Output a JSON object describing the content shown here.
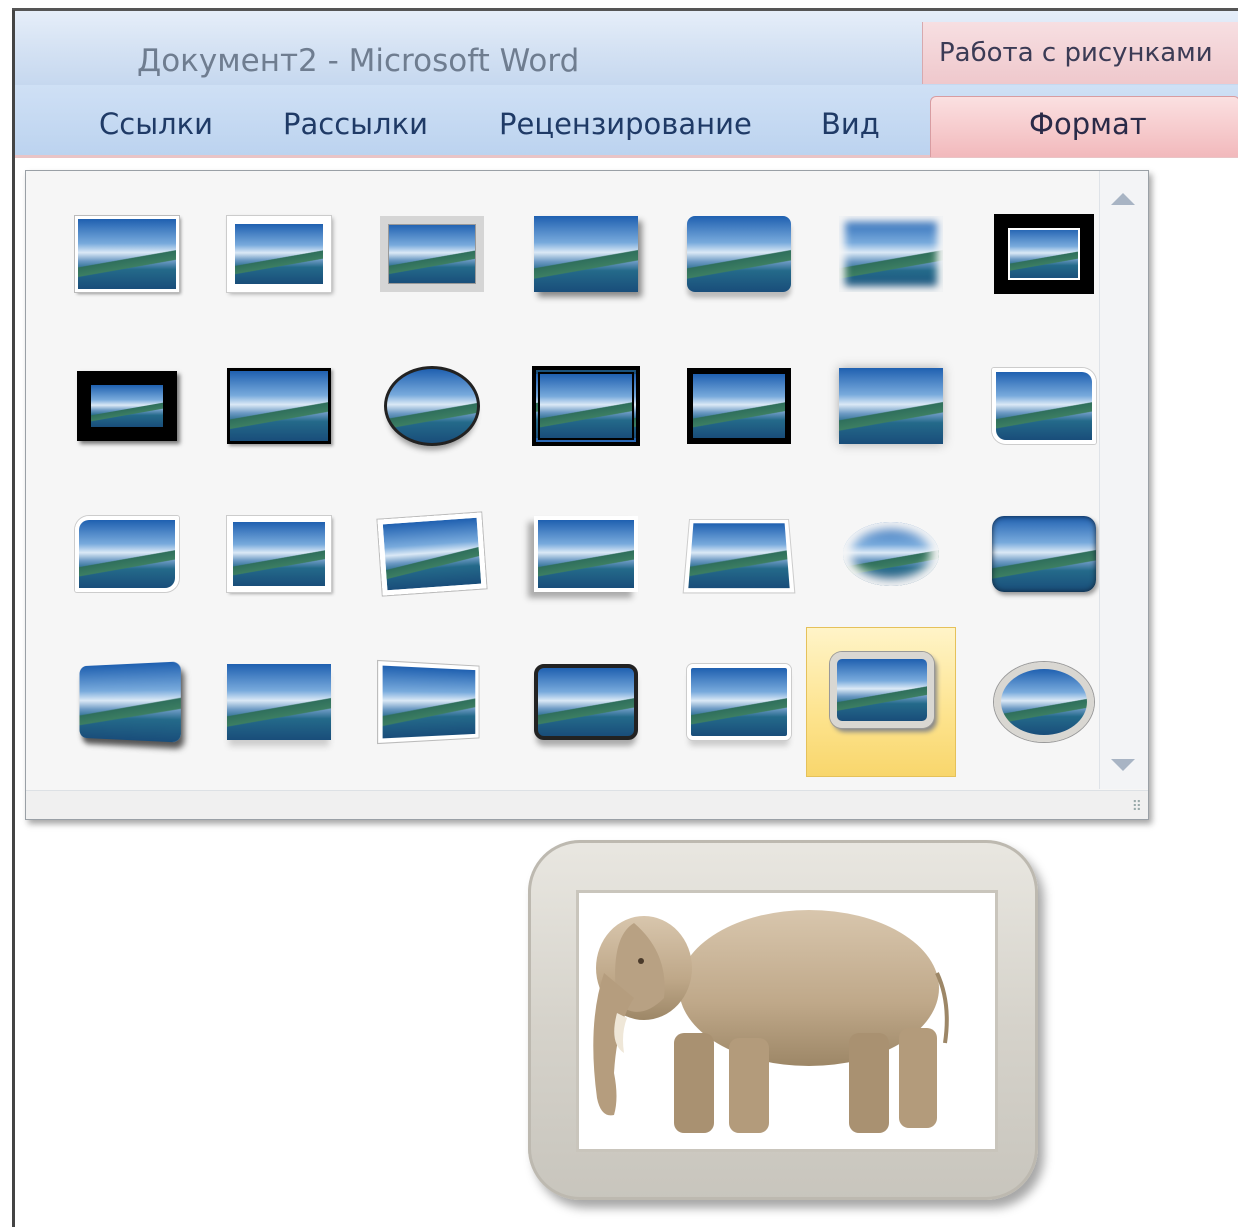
{
  "window": {
    "title": "Документ2 - Microsoft Word",
    "context_group": "Работа с рисунками"
  },
  "ribbon": {
    "tabs": [
      {
        "label": "Ссылки"
      },
      {
        "label": "Рассылки"
      },
      {
        "label": "Рецензирование"
      },
      {
        "label": "Вид"
      }
    ],
    "active_tab": "Формат"
  },
  "gallery": {
    "name": "picture-styles",
    "rows": 4,
    "columns": 7,
    "selected_index": 26,
    "styles": [
      "simple-frame-white",
      "beveled-matte-white",
      "metal-frame",
      "drop-shadow-rectangle",
      "reflected-rounded-rectangle",
      "soft-edge-rectangle",
      "double-frame-black",
      "thick-matte-black",
      "simple-frame-black",
      "beveled-oval-black",
      "compound-frame-black",
      "moderate-frame-black",
      "center-shadow-rectangle",
      "rounded-diagonal-corner-white",
      "snip-diagonal-corner-white",
      "moderate-frame-white",
      "rotated-white",
      "perspective-shadow-white",
      "relaxed-perspective-white",
      "soft-edge-oval",
      "bevel-rectangle",
      "bevel-perspective",
      "reflected-bevel-white",
      "bevel-perspective-left-white",
      "reflected-bevel-black",
      "reflected-bevel-white-2",
      "metal-rounded-rectangle",
      "metal-oval"
    ],
    "selected_color": "#fde38d"
  },
  "document": {
    "picture": "elephant",
    "applied_style": "metal-rounded-rectangle"
  }
}
